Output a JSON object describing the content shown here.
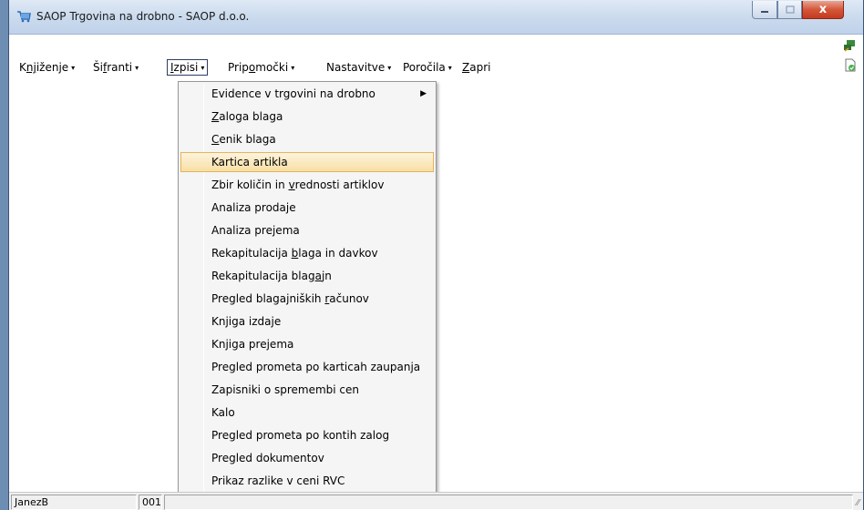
{
  "window": {
    "title": "SAOP Trgovina na drobno - SAOP d.o.o.",
    "close_glyph": "x",
    "icons": [
      "cart-icon",
      "minimize-icon",
      "maximize-icon",
      "close-icon",
      "connection-icon",
      "document-check-icon"
    ]
  },
  "menubar": {
    "items": [
      {
        "label_pre": "K",
        "label_u": "nj",
        "label_post": "iženje",
        "has_arrow": true
      },
      {
        "label_pre": "Ši",
        "label_u": "f",
        "label_post": "ranti",
        "has_arrow": true
      },
      {
        "label_pre": "",
        "label_u": "I",
        "label_post": "zpisi",
        "has_arrow": true
      },
      {
        "label_pre": "Prip",
        "label_u": "o",
        "label_post": "močki",
        "has_arrow": true
      },
      {
        "label_pre": "Nastavitve",
        "label_u": "",
        "label_post": "",
        "has_arrow": true
      },
      {
        "label_pre": "Poročila",
        "label_u": "",
        "label_post": "",
        "has_arrow": true
      },
      {
        "label_pre": "",
        "label_u": "Z",
        "label_post": "apri",
        "has_arrow": false
      }
    ],
    "active_index": 2,
    "arrow_glyph": "▾"
  },
  "dropdown": {
    "items": [
      {
        "pre": "Evidence v trgovini na drobno",
        "u": "",
        "post": "",
        "submenu": true
      },
      {
        "pre": "",
        "u": "Z",
        "post": "aloga blaga",
        "submenu": false
      },
      {
        "pre": "",
        "u": "C",
        "post": "enik blaga",
        "submenu": false
      },
      {
        "pre": "Kartica artikla",
        "u": "",
        "post": "",
        "submenu": false
      },
      {
        "pre": "Zbir količin in ",
        "u": "v",
        "post": "rednosti artiklov",
        "submenu": false
      },
      {
        "pre": "Analiza prodaje",
        "u": "",
        "post": "",
        "submenu": false
      },
      {
        "pre": "Analiza prejema",
        "u": "",
        "post": "",
        "submenu": false
      },
      {
        "pre": "Rekapitulacija ",
        "u": "b",
        "post": "laga in davkov",
        "submenu": false
      },
      {
        "pre": "Rekapitulacija blag",
        "u": "a",
        "post": "jn",
        "submenu": false
      },
      {
        "pre": "Pregled blagajniških ",
        "u": "r",
        "post": "ačunov",
        "submenu": false
      },
      {
        "pre": "Knjiga izdaje",
        "u": "",
        "post": "",
        "submenu": false
      },
      {
        "pre": "Knjiga prejema",
        "u": "",
        "post": "",
        "submenu": false
      },
      {
        "pre": "Pregled prometa po karticah zaupanja",
        "u": "",
        "post": "",
        "submenu": false
      },
      {
        "pre": "Zapisniki o spremembi cen",
        "u": "",
        "post": "",
        "submenu": false
      },
      {
        "pre": "Kalo",
        "u": "",
        "post": "",
        "submenu": false
      },
      {
        "pre": "Pregled prometa po kontih zalog",
        "u": "",
        "post": "",
        "submenu": false
      },
      {
        "pre": "Pregled dokumentov",
        "u": "",
        "post": "",
        "submenu": false
      },
      {
        "pre": "Prikaz razlike v ceni RVC",
        "u": "",
        "post": "",
        "submenu": false
      }
    ],
    "highlighted_index": 3,
    "submenu_glyph": "▶"
  },
  "statusbar": {
    "user": "JanezB",
    "code": "001",
    "grip_glyph": "⁄⁄"
  },
  "colors": {
    "highlight_bg": "#f8e0a4",
    "highlight_border": "#e5b35c",
    "close_red": "#c53b1f"
  }
}
